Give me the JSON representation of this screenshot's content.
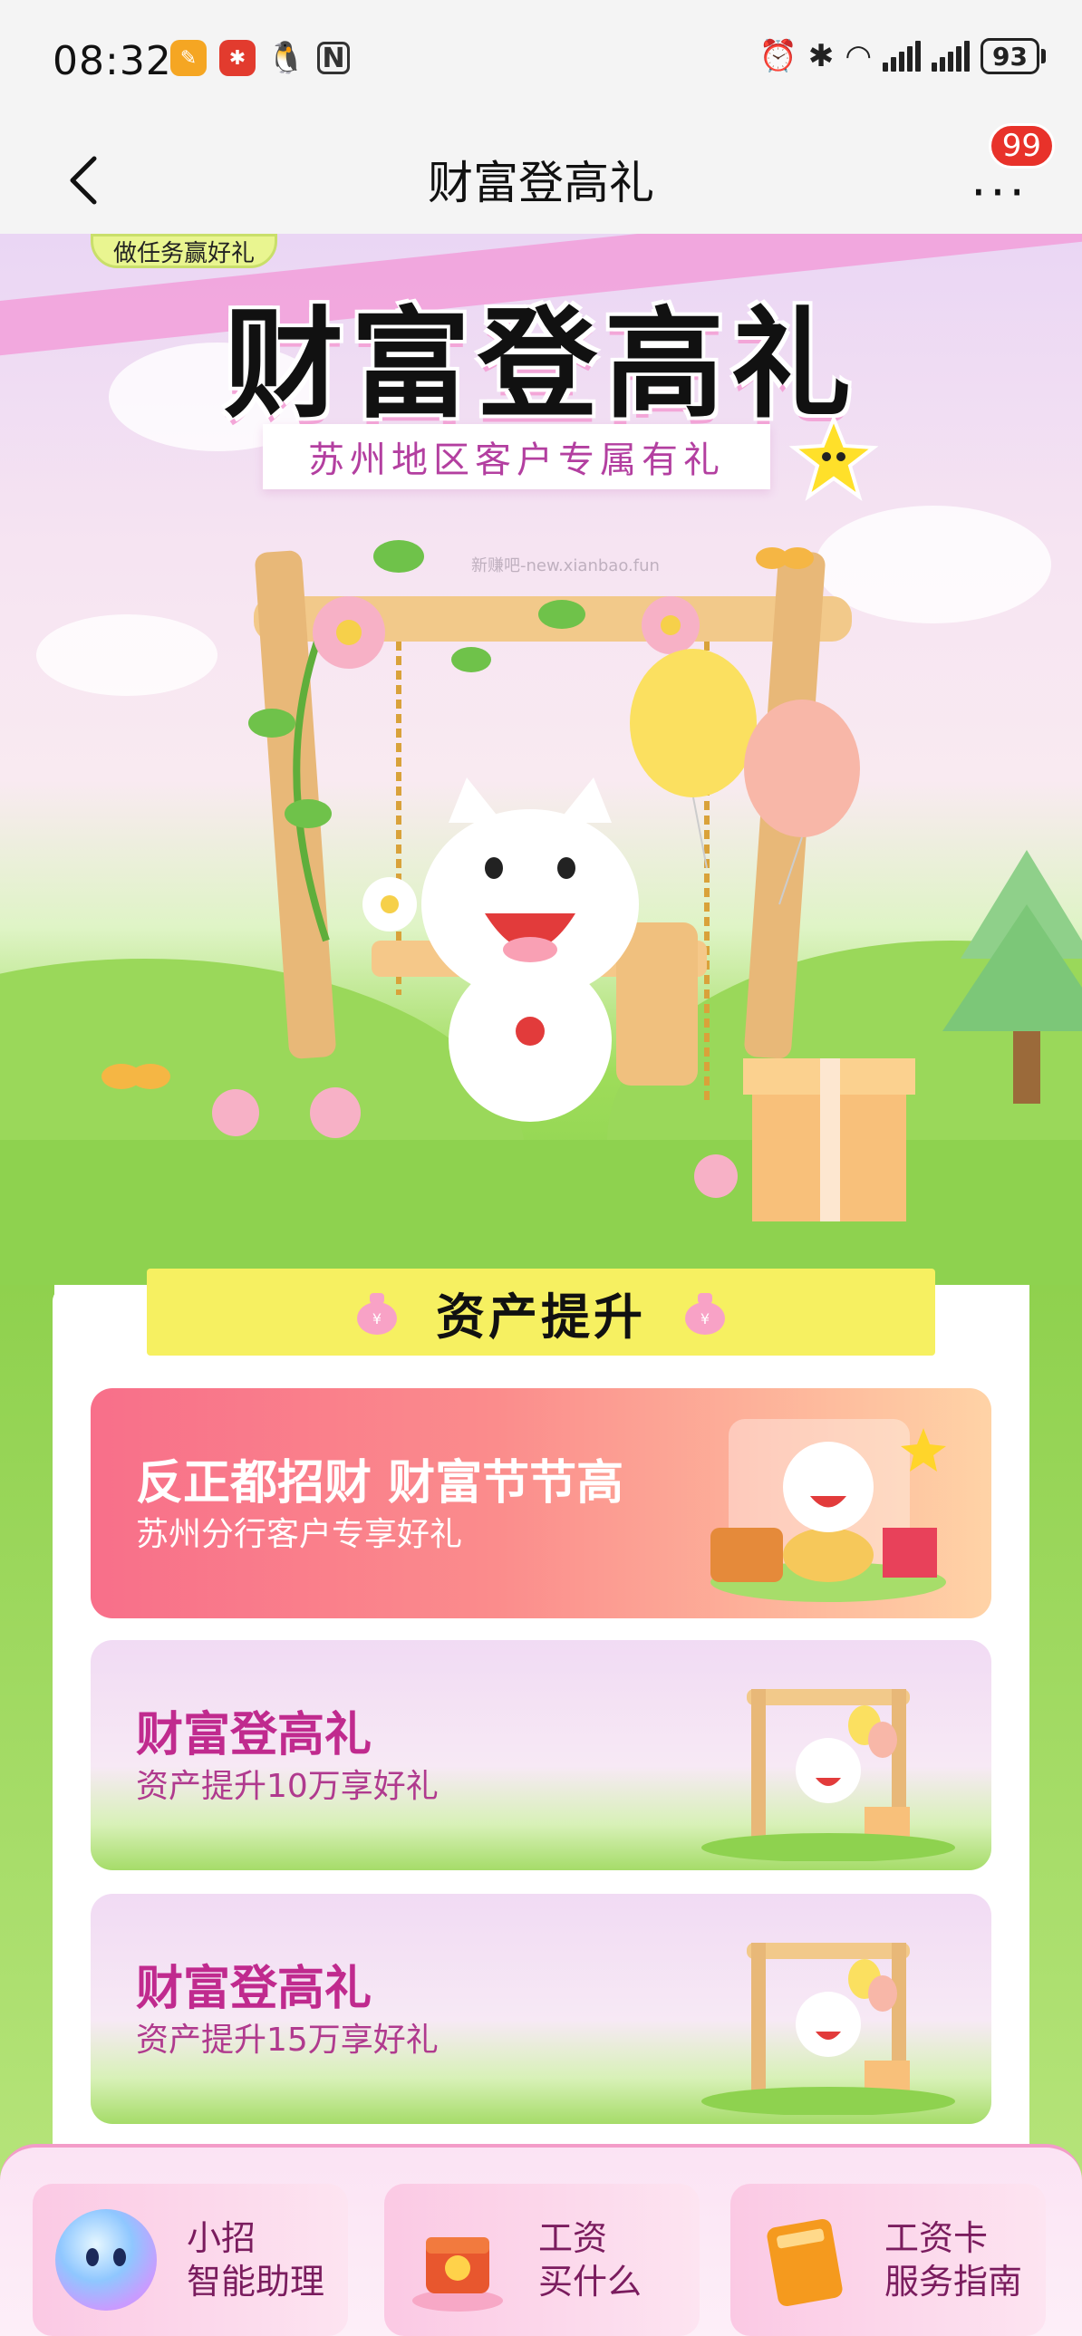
{
  "status_bar": {
    "time": "08:32",
    "battery": "93",
    "notification_icons": [
      "orange-app-icon",
      "red-app-icon",
      "qq-icon",
      "nfc-icon"
    ],
    "system_icons": [
      "alarm-icon",
      "bluetooth-icon",
      "wifi-icon",
      "signal-icon",
      "signal-icon"
    ]
  },
  "nav": {
    "title": "财富登高礼",
    "badge_count": "99",
    "more_label": "···"
  },
  "hero": {
    "task_tag": "做任务赢好礼",
    "title": "财富登高礼",
    "subtitle": "苏州地区客户专属有礼",
    "watermark": "新赚吧-new.xianbao.fun"
  },
  "section": {
    "title": "资产提升"
  },
  "cards": [
    {
      "title": "反正都招财 财富节节高",
      "desc": "苏州分行客户专享好礼"
    },
    {
      "title": "财富登高礼",
      "desc": "资产提升10万享好礼"
    },
    {
      "title": "财富登高礼",
      "desc": "资产提升15万享好礼"
    }
  ],
  "dock": [
    {
      "line1": "小招",
      "line2": "智能助理"
    },
    {
      "line1": "工资",
      "line2": "买什么"
    },
    {
      "line1": "工资卡",
      "line2": "服务指南"
    }
  ],
  "colors": {
    "brand_pink": "#c02a8e",
    "badge_red": "#e8322a",
    "header_yellow": "#f6f061",
    "grass_green": "#86d04b"
  }
}
